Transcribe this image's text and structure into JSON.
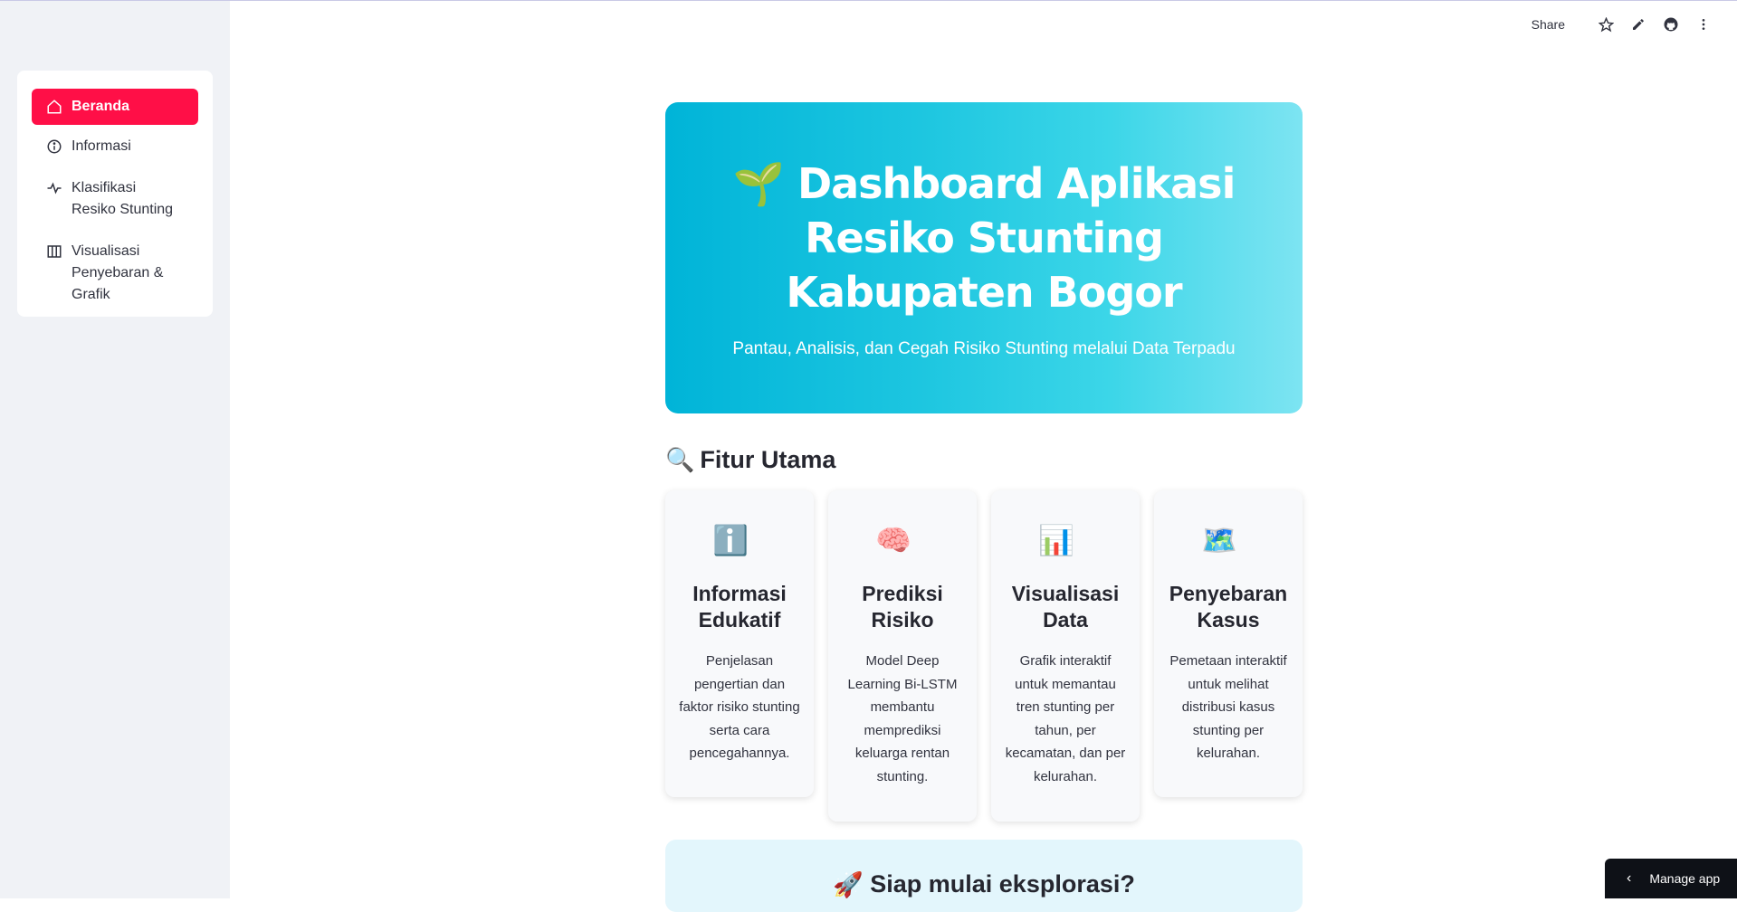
{
  "sidebar": {
    "items": [
      {
        "label": "Beranda",
        "icon": "home-icon",
        "active": true
      },
      {
        "label": "Informasi",
        "icon": "info-icon",
        "active": false
      },
      {
        "label": "Klasifikasi Resiko Stunting",
        "icon": "activity-icon",
        "active": false
      },
      {
        "label": "Visualisasi Penyebaran & Grafik",
        "icon": "map-icon",
        "active": false
      }
    ]
  },
  "header": {
    "share_label": "Share"
  },
  "hero": {
    "emoji": "🌱",
    "title": "Dashboard Aplikasi Resiko Stunting Kabupaten Bogor",
    "subtitle": "Pantau, Analisis, dan Cegah Risiko Stunting melalui Data Terpadu"
  },
  "features": {
    "emoji": "🔍",
    "title": "Fitur Utama",
    "cards": [
      {
        "emoji": "ℹ️",
        "title": "Informasi Edukatif",
        "text": "Penjelasan pengertian dan faktor risiko stunting serta cara pencegahannya."
      },
      {
        "emoji": "🧠",
        "title": "Prediksi Risiko",
        "text": "Model Deep Learning Bi-LSTM membantu memprediksi keluarga rentan stunting."
      },
      {
        "emoji": "📊",
        "title": "Visualisasi Data",
        "text": "Grafik interaktif untuk memantau tren stunting per tahun, per kecamatan, dan per kelurahan."
      },
      {
        "emoji": "🗺️",
        "title": "Penyebaran Kasus",
        "text": "Pemetaan interaktif untuk melihat distribusi kasus stunting per kelurahan."
      }
    ]
  },
  "cta": {
    "emoji": "🚀",
    "text": "Siap mulai eksplorasi?"
  },
  "footer": {
    "manage_label": "Manage app"
  },
  "colors": {
    "accent": "#ff0f47",
    "sidebar_bg": "#f0f2f6",
    "hero_start": "#00b4d8",
    "hero_end": "#7de4f2",
    "cta_bg": "#e3f6fc"
  }
}
